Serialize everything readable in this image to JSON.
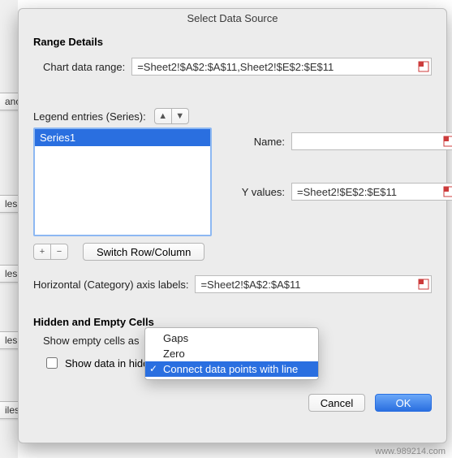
{
  "bg_tabs": [
    "anc",
    "les",
    "les",
    "les",
    "iles"
  ],
  "dialog": {
    "title": "Select Data Source",
    "range_section": "Range Details",
    "chart_data_range_label": "Chart data range:",
    "chart_data_range_value": "=Sheet2!$A$2:$A$11,Sheet2!$E$2:$E$11",
    "legend_label": "Legend entries (Series):",
    "name_label": "Name:",
    "name_value": "",
    "yvalues_label": "Y values:",
    "yvalues_value": "=Sheet2!$E$2:$E$11",
    "series": [
      "Series1"
    ],
    "selected_series_index": 0,
    "add_btn": "+",
    "remove_btn": "−",
    "switch_btn": "Switch Row/Column",
    "axis_label": "Horizontal (Category) axis labels:",
    "axis_value": "=Sheet2!$A$2:$A$11",
    "hidden_section": "Hidden and Empty Cells",
    "show_empty_label": "Show empty cells as",
    "dropdown_options": [
      "Gaps",
      "Zero",
      "Connect data points with line"
    ],
    "dropdown_selected_index": 2,
    "show_hidden_label": "Show data in hidden rows and columns",
    "show_hidden_checked": false,
    "cancel": "Cancel",
    "ok": "OK"
  },
  "watermark": "www.989214.com"
}
